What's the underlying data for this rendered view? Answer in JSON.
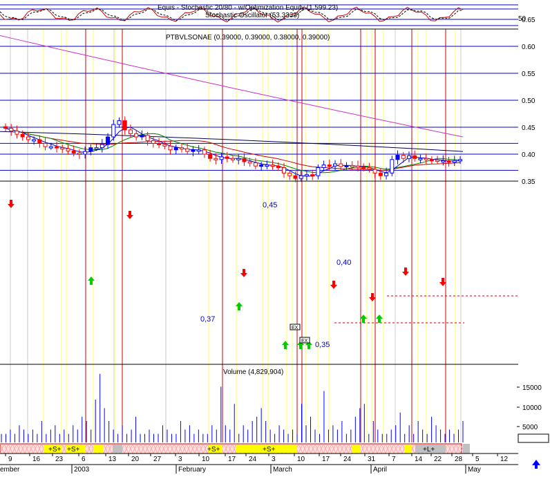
{
  "stochastic_panel": {
    "title_line1": "Equis - Stochastic 20/80 - w/Optimization Equity (1,599.23)",
    "title_line2": "Stochastic Oscillator (53.3333)",
    "right_tick": "50"
  },
  "price_panel": {
    "title": "PTBVLSONAE (0.39000, 0.39000, 0.38000, 0.39000)",
    "annotations": [
      "0,45",
      "0,40",
      "0,37",
      "0,35"
    ],
    "exit_label": "EX"
  },
  "volume_panel": {
    "title": "Volume (4,829,904)"
  },
  "signal_strip": {
    "labels": [
      "+S+",
      "+S+",
      "+S+",
      "+S+",
      "+L+"
    ]
  },
  "x_axis": {
    "day_labels": [
      "9",
      "16",
      "23",
      "6",
      "13",
      "20",
      "27",
      "3",
      "10",
      "17",
      "24",
      "3",
      "10",
      "17",
      "24",
      "31",
      "7",
      "14",
      "22",
      "28",
      "5",
      "12"
    ],
    "month_labels": [
      "ember",
      "2003",
      "February",
      "March",
      "April",
      "May"
    ]
  },
  "colors": {
    "up_candle": "#0000ff",
    "down_candle": "#ff0000",
    "ma_blue": "#0000cc",
    "ma_green": "#008000",
    "ma_red": "#cc0000",
    "ma_navy": "#000060",
    "ma_magenta": "#cc33cc",
    "buy_arrow": "#00cc00",
    "sell_arrow": "#ff0000",
    "grid_blue": "#0000cc",
    "vline_red": "#cc0000",
    "vline_yellow": "#ffff66",
    "signal_yellow": "#ffff00"
  },
  "chart_data": [
    {
      "type": "line",
      "name": "Stochastic Oscillator",
      "ylabel": "",
      "ytick_labels": [
        "50"
      ],
      "value": 53.3333
    },
    {
      "type": "candlestick",
      "name": "PTBVLSONAE",
      "ylim": [
        0.325,
        0.665
      ],
      "ytick_labels": [
        "0.35",
        "0.40",
        "0.45",
        "0.50",
        "0.55",
        "0.60",
        "0.65"
      ],
      "last_ohlc": [
        0.39,
        0.39,
        0.38,
        0.39
      ],
      "horizontal_levels": [
        0.35,
        0.37,
        0.4,
        0.45
      ],
      "close_series": [
        0.448,
        0.443,
        0.437,
        0.432,
        0.427,
        0.427,
        0.42,
        0.414,
        0.414,
        0.412,
        0.41,
        0.406,
        0.402,
        0.4,
        0.405,
        0.412,
        0.412,
        0.418,
        0.432,
        0.455,
        0.462,
        0.445,
        0.438,
        0.432,
        0.435,
        0.425,
        0.42,
        0.418,
        0.415,
        0.408,
        0.412,
        0.41,
        0.405,
        0.408,
        0.408,
        0.4,
        0.392,
        0.39,
        0.395,
        0.392,
        0.39,
        0.392,
        0.386,
        0.384,
        0.378,
        0.38,
        0.38,
        0.378,
        0.375,
        0.365,
        0.36,
        0.355,
        0.36,
        0.362,
        0.36,
        0.375,
        0.38,
        0.378,
        0.382,
        0.377,
        0.379,
        0.378,
        0.376,
        0.375,
        0.372,
        0.365,
        0.36,
        0.365,
        0.39,
        0.398,
        0.392,
        0.397,
        0.392,
        0.392,
        0.39,
        0.389,
        0.388,
        0.388,
        0.385,
        0.388,
        0.39
      ],
      "moving_averages": [
        {
          "color": "#000060",
          "values": [
            0.442,
            0.43,
            0.405
          ]
        },
        {
          "color": "#cc33cc",
          "values": [
            0.62,
            0.52,
            0.432
          ]
        }
      ]
    },
    {
      "type": "bar",
      "name": "Volume",
      "ytick_labels": [
        "5000",
        "10000",
        "15000"
      ],
      "last_value": 4829904,
      "values": [
        2,
        2,
        3,
        2,
        4,
        3,
        2,
        3,
        2,
        5,
        2,
        3,
        4,
        2,
        3,
        2,
        4,
        3,
        6,
        5,
        3,
        10,
        16,
        8,
        5,
        3,
        2,
        4,
        2,
        3,
        6,
        2,
        2,
        3,
        2,
        2,
        4,
        3,
        2,
        2,
        5,
        3,
        4,
        2,
        3,
        2,
        2,
        4,
        3,
        13,
        4,
        3,
        9,
        2,
        4,
        3,
        5,
        6,
        8,
        5,
        3,
        2,
        4,
        3,
        2,
        3,
        2,
        9,
        4,
        6,
        3,
        2,
        12,
        3,
        4,
        3,
        5,
        2,
        3,
        6,
        8,
        9,
        2,
        5,
        3,
        2,
        2,
        3,
        4,
        7,
        2,
        4,
        2,
        5,
        3,
        2,
        6,
        4,
        3,
        2,
        3,
        2,
        3,
        5
      ]
    }
  ]
}
